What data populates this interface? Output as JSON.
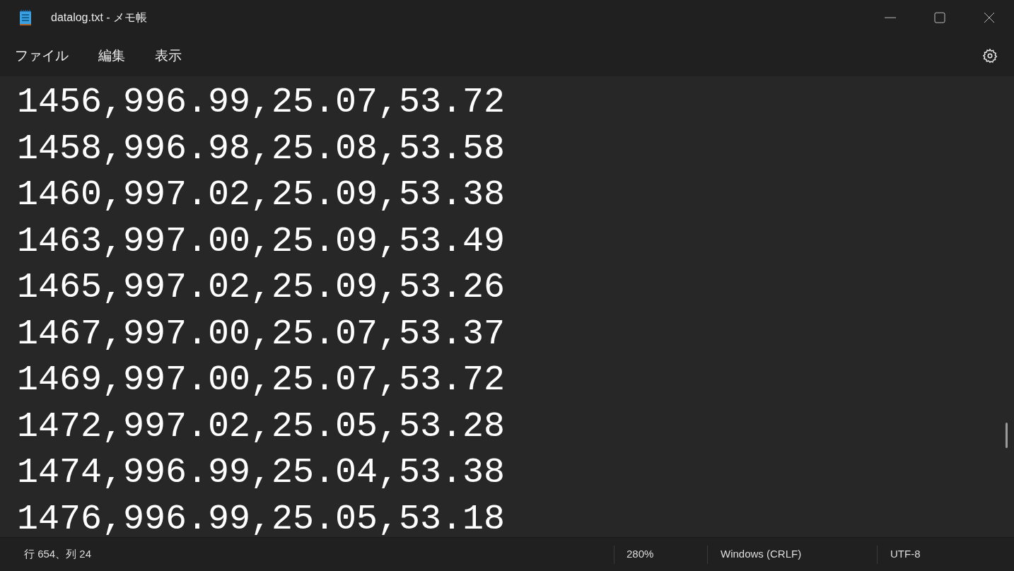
{
  "window": {
    "title": "datalog.txt - メモ帳"
  },
  "menu": [
    "ファイル",
    "編集",
    "表示"
  ],
  "lines": [
    "1456,996.99,25.07,53.72",
    "1458,996.98,25.08,53.58",
    "1460,997.02,25.09,53.38",
    "1463,997.00,25.09,53.49",
    "1465,997.02,25.09,53.26",
    "1467,997.00,25.07,53.37",
    "1469,997.00,25.07,53.72",
    "1472,997.02,25.05,53.28",
    "1474,996.99,25.04,53.38",
    "1476,996.99,25.05,53.18"
  ],
  "status_bar": {
    "position": "行 654、列 24",
    "zoom": "280%",
    "line_ending": "Windows (CRLF)",
    "encoding": "UTF-8"
  }
}
